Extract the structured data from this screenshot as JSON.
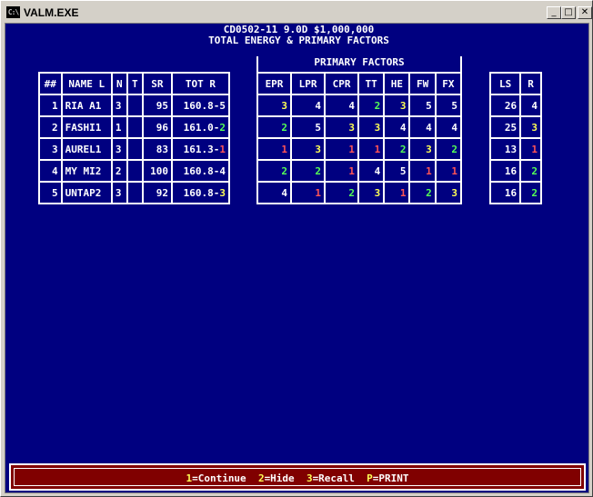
{
  "window": {
    "title": "VALM.EXE",
    "icon_text": "C:\\"
  },
  "header": {
    "line1": "CD0502-11 9.0D $1,000,000",
    "line2": "TOTAL ENERGY & PRIMARY FACTORS"
  },
  "primary_factors_title": "PRIMARY FACTORS",
  "left_table": {
    "headers": [
      "##",
      "NAME L",
      "N",
      "T",
      "SR",
      "TOT R"
    ],
    "rows": [
      {
        "num": "1",
        "name": "RIA A1",
        "n": "3",
        "t": "",
        "sr": "95",
        "tot": "160.8-",
        "r": "5",
        "r_color": "w"
      },
      {
        "num": "2",
        "name": "FASHI1",
        "n": "1",
        "t": "",
        "sr": "96",
        "tot": "161.0-",
        "r": "2",
        "r_color": "g"
      },
      {
        "num": "3",
        "name": "AUREL1",
        "n": "3",
        "t": "",
        "sr": "83",
        "tot": "161.3-",
        "r": "1",
        "r_color": "rd"
      },
      {
        "num": "4",
        "name": "MY MI2",
        "n": "2",
        "t": "",
        "sr": "100",
        "tot": "160.8-",
        "r": "4",
        "r_color": "w"
      },
      {
        "num": "5",
        "name": "UNTAP2",
        "n": "3",
        "t": "",
        "sr": "92",
        "tot": "160.8-",
        "r": "3",
        "r_color": "y"
      }
    ]
  },
  "factor_table": {
    "headers": [
      "EPR",
      "LPR",
      "CPR",
      "TT",
      "HE",
      "FW",
      "FX"
    ],
    "rows": [
      [
        {
          "v": "3",
          "c": "y"
        },
        {
          "v": "4",
          "c": "w"
        },
        {
          "v": "4",
          "c": "w"
        },
        {
          "v": "2",
          "c": "g"
        },
        {
          "v": "3",
          "c": "y"
        },
        {
          "v": "5",
          "c": "w"
        },
        {
          "v": "5",
          "c": "w"
        }
      ],
      [
        {
          "v": "2",
          "c": "g"
        },
        {
          "v": "5",
          "c": "w"
        },
        {
          "v": "3",
          "c": "y"
        },
        {
          "v": "3",
          "c": "y"
        },
        {
          "v": "4",
          "c": "w"
        },
        {
          "v": "4",
          "c": "w"
        },
        {
          "v": "4",
          "c": "w"
        }
      ],
      [
        {
          "v": "1",
          "c": "rd"
        },
        {
          "v": "3",
          "c": "y"
        },
        {
          "v": "1",
          "c": "rd"
        },
        {
          "v": "1",
          "c": "rd"
        },
        {
          "v": "2",
          "c": "g"
        },
        {
          "v": "3",
          "c": "y"
        },
        {
          "v": "2",
          "c": "g"
        }
      ],
      [
        {
          "v": "2",
          "c": "g"
        },
        {
          "v": "2",
          "c": "g"
        },
        {
          "v": "1",
          "c": "rd"
        },
        {
          "v": "4",
          "c": "w"
        },
        {
          "v": "5",
          "c": "w"
        },
        {
          "v": "1",
          "c": "rd"
        },
        {
          "v": "1",
          "c": "rd"
        }
      ],
      [
        {
          "v": "4",
          "c": "w"
        },
        {
          "v": "1",
          "c": "rd"
        },
        {
          "v": "2",
          "c": "g"
        },
        {
          "v": "3",
          "c": "y"
        },
        {
          "v": "1",
          "c": "rd"
        },
        {
          "v": "2",
          "c": "g"
        },
        {
          "v": "3",
          "c": "y"
        }
      ]
    ]
  },
  "ls_table": {
    "headers": [
      "LS",
      "R"
    ],
    "rows": [
      {
        "ls": "26",
        "r": "4",
        "c": "w"
      },
      {
        "ls": "25",
        "r": "3",
        "c": "y"
      },
      {
        "ls": "13",
        "r": "1",
        "c": "rd"
      },
      {
        "ls": "16",
        "r": "2",
        "c": "g"
      },
      {
        "ls": "16",
        "r": "2",
        "c": "g"
      }
    ]
  },
  "footer": {
    "items": [
      {
        "key": "1",
        "label": "=Continue"
      },
      {
        "key": "2",
        "label": "=Hide"
      },
      {
        "key": "3",
        "label": "=Recall"
      },
      {
        "key": "P",
        "label": "=PRINT"
      }
    ]
  },
  "colors": {
    "background": "#000080",
    "footer_bg": "#800000",
    "yellow": "#ffff55",
    "green": "#55ff55",
    "red": "#ff5555"
  }
}
